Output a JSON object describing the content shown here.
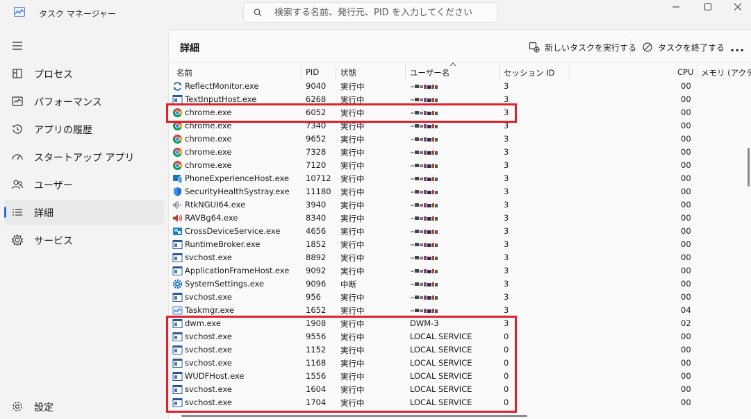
{
  "window": {
    "title": "タスク マネージャー",
    "search_placeholder": "検索する名前、発行元、PID を入力してください"
  },
  "sidebar": {
    "items": [
      {
        "label": "プロセス",
        "icon": "processes-icon",
        "active": false
      },
      {
        "label": "パフォーマンス",
        "icon": "performance-icon",
        "active": false
      },
      {
        "label": "アプリの履歴",
        "icon": "history-icon",
        "active": false
      },
      {
        "label": "スタートアップ アプリ",
        "icon": "startup-icon",
        "active": false
      },
      {
        "label": "ユーザー",
        "icon": "users-icon",
        "active": false
      },
      {
        "label": "詳細",
        "icon": "details-icon",
        "active": true
      },
      {
        "label": "サービス",
        "icon": "services-icon",
        "active": false
      }
    ],
    "settings_label": "設定"
  },
  "main": {
    "title": "詳細",
    "run_new_task": "新しいタスクを実行する",
    "end_task": "タスクを終了する",
    "more": "...",
    "columns": {
      "name": "名前",
      "pid": "PID",
      "status": "状態",
      "user": "ユーザー名",
      "session": "セッション ID",
      "cpu": "CPU",
      "memory": "メモリ (アクティ"
    }
  },
  "processes": [
    {
      "name": "ReflectMonitor.exe",
      "pid": "9040",
      "status": "実行中",
      "user": "",
      "session": "3",
      "cpu": "00",
      "icon": "reflect"
    },
    {
      "name": "TextInputHost.exe",
      "pid": "6268",
      "status": "実行中",
      "user": "",
      "session": "3",
      "cpu": "00",
      "icon": "app"
    },
    {
      "name": "chrome.exe",
      "pid": "6052",
      "status": "実行中",
      "user": "",
      "session": "3",
      "cpu": "00",
      "icon": "chrome"
    },
    {
      "name": "chrome.exe",
      "pid": "7340",
      "status": "実行中",
      "user": "",
      "session": "3",
      "cpu": "00",
      "icon": "chrome"
    },
    {
      "name": "chrome.exe",
      "pid": "9652",
      "status": "実行中",
      "user": "",
      "session": "3",
      "cpu": "00",
      "icon": "chrome"
    },
    {
      "name": "chrome.exe",
      "pid": "7328",
      "status": "実行中",
      "user": "",
      "session": "3",
      "cpu": "00",
      "icon": "chrome"
    },
    {
      "name": "chrome.exe",
      "pid": "7120",
      "status": "実行中",
      "user": "",
      "session": "3",
      "cpu": "00",
      "icon": "chrome"
    },
    {
      "name": "PhoneExperienceHost.exe",
      "pid": "10712",
      "status": "実行中",
      "user": "",
      "session": "3",
      "cpu": "00",
      "icon": "phone"
    },
    {
      "name": "SecurityHealthSystray.exe",
      "pid": "11180",
      "status": "実行中",
      "user": "",
      "session": "3",
      "cpu": "00",
      "icon": "shield"
    },
    {
      "name": "RtkNGUI64.exe",
      "pid": "3940",
      "status": "実行中",
      "user": "",
      "session": "3",
      "cpu": "00",
      "icon": "audio"
    },
    {
      "name": "RAVBg64.exe",
      "pid": "8340",
      "status": "実行中",
      "user": "",
      "session": "3",
      "cpu": "00",
      "icon": "speaker"
    },
    {
      "name": "CrossDeviceService.exe",
      "pid": "4656",
      "status": "実行中",
      "user": "",
      "session": "3",
      "cpu": "00",
      "icon": "cross"
    },
    {
      "name": "RuntimeBroker.exe",
      "pid": "1852",
      "status": "実行中",
      "user": "",
      "session": "3",
      "cpu": "00",
      "icon": "app"
    },
    {
      "name": "svchost.exe",
      "pid": "8892",
      "status": "実行中",
      "user": "",
      "session": "3",
      "cpu": "00",
      "icon": "app"
    },
    {
      "name": "ApplicationFrameHost.exe",
      "pid": "9092",
      "status": "実行中",
      "user": "",
      "session": "3",
      "cpu": "00",
      "icon": "app"
    },
    {
      "name": "SystemSettings.exe",
      "pid": "9096",
      "status": "中断",
      "user": "",
      "session": "3",
      "cpu": "00",
      "icon": "gear"
    },
    {
      "name": "svchost.exe",
      "pid": "956",
      "status": "実行中",
      "user": "",
      "session": "3",
      "cpu": "00",
      "icon": "app"
    },
    {
      "name": "Taskmgr.exe",
      "pid": "1652",
      "status": "実行中",
      "user": "",
      "session": "3",
      "cpu": "04",
      "icon": "taskmgr"
    },
    {
      "name": "dwm.exe",
      "pid": "1908",
      "status": "実行中",
      "user": "DWM-3",
      "session": "3",
      "cpu": "02",
      "icon": "app"
    },
    {
      "name": "svchost.exe",
      "pid": "9556",
      "status": "実行中",
      "user": "LOCAL SERVICE",
      "session": "0",
      "cpu": "00",
      "icon": "app"
    },
    {
      "name": "svchost.exe",
      "pid": "1152",
      "status": "実行中",
      "user": "LOCAL SERVICE",
      "session": "0",
      "cpu": "00",
      "icon": "app"
    },
    {
      "name": "svchost.exe",
      "pid": "1168",
      "status": "実行中",
      "user": "LOCAL SERVICE",
      "session": "0",
      "cpu": "00",
      "icon": "app"
    },
    {
      "name": "WUDFHost.exe",
      "pid": "1556",
      "status": "実行中",
      "user": "LOCAL SERVICE",
      "session": "0",
      "cpu": "00",
      "icon": "app"
    },
    {
      "name": "svchost.exe",
      "pid": "1604",
      "status": "実行中",
      "user": "LOCAL SERVICE",
      "session": "0",
      "cpu": "00",
      "icon": "app"
    },
    {
      "name": "svchost.exe",
      "pid": "1704",
      "status": "実行中",
      "user": "LOCAL SERVICE",
      "session": "0",
      "cpu": "00",
      "icon": "app"
    }
  ],
  "colors": {
    "accent": "#2a6fdb",
    "highlight": "#e0202b"
  }
}
